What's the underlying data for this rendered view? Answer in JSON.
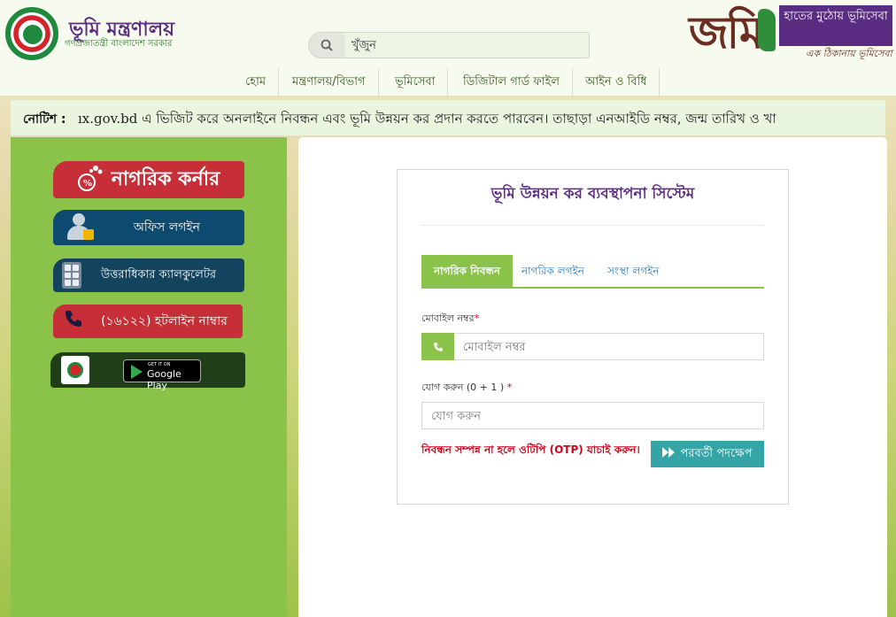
{
  "header": {
    "site_title": "ভূমি মন্ত্রণালয়",
    "site_subtitle": "গণপ্রজাতন্ত্রী বাংলাদেশ সরকার",
    "search_placeholder": "খুঁজুন",
    "brand_word": "জমি",
    "brand_tagline": "হাতের মুঠোয় ভূমিসেবা",
    "brand_slogan": "এক ঠিকানায় ভূমিসেবা"
  },
  "nav": {
    "items": [
      "হোম",
      "মন্ত্রণালয়/বিভাগ",
      "ভূমিসেবা",
      "ডিজিটাল গার্ড ফাইল",
      "আইন ও বিধি"
    ]
  },
  "notice": {
    "label": "নোটিশ :",
    "text": "ıx.gov.bd এ ভিজিট করে অনলাইনে নিবন্ধন এবং ভূমি উন্নয়ন কর প্রদান করতে পারবেন। তাছাড়া এনআইডি নম্বর, জন্ম তারিখ ও খা"
  },
  "sidebar": {
    "corner_title": "নাগরিক কর্নার",
    "office_login": "অফিস লগইন",
    "calculator": "উত্তরাধিকার ক্যালকুলেটর",
    "hotline": "(১৬১২২) হটলাইন নাম্বার",
    "gplay_small": "GET IT ON",
    "gplay_big": "Google Play"
  },
  "form": {
    "title": "ভূমি উন্নয়ন কর ব্যবস্থাপনা সিস্টেম",
    "tabs": [
      "নাগরিক নিবন্ধন",
      "নাগরিক লগইন",
      "সংস্থা লগইন"
    ],
    "mobile_label": "মোবাইল নম্বর",
    "mobile_placeholder": "মোবাইল নম্বর",
    "sum_label": "যোগ করুন (0 + 1 )",
    "sum_placeholder": "যোগ করুন",
    "required_mark": "*",
    "otp_note": "নিবন্ধন সম্পন্ন না হলে ওটিপি (OTP) যাচাই করুন।",
    "next_button": "পরবর্তী পদক্ষেপ"
  },
  "colors": {
    "accent_green": "#8bc34a",
    "brand_purple": "#5b2d82",
    "alert_red": "#d0021b",
    "button_teal": "#35a4a6"
  }
}
